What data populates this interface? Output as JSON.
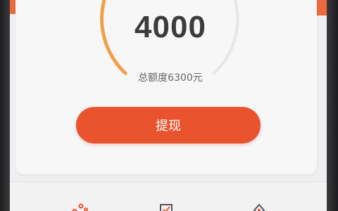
{
  "balance": {
    "amount": "4000",
    "total_label": "总额度6300元",
    "gauge_fill_fraction": 0.3
  },
  "actions": {
    "withdraw_label": "提现"
  },
  "colors": {
    "accent": "#e9542f",
    "gauge_track": "#e6e6e8",
    "gauge_fill": "#f0a04a"
  },
  "bottom_nav": {
    "icons": [
      "dots-icon",
      "check-box-icon",
      "diamond-icon"
    ]
  }
}
